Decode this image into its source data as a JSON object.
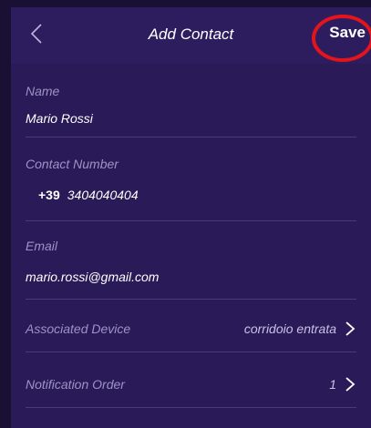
{
  "navbar": {
    "title": "Add Contact",
    "save_label": "Save",
    "back_icon": "chevron-left-icon"
  },
  "form": {
    "name": {
      "label": "Name",
      "value": "Mario Rossi"
    },
    "contact_number": {
      "label": "Contact Number",
      "prefix": "+39",
      "value": "3404040404"
    },
    "email": {
      "label": "Email",
      "value": "mario.rossi@gmail.com"
    },
    "associated_device": {
      "label": "Associated Device",
      "value": "corridoio entrata"
    },
    "notification_order": {
      "label": "Notification Order",
      "value": "1"
    }
  },
  "colors": {
    "background": "#2a1a57",
    "navbar": "#2e1d5e",
    "label": "#9d93c7",
    "value": "#ffffff",
    "annotation": "#e3141b"
  }
}
